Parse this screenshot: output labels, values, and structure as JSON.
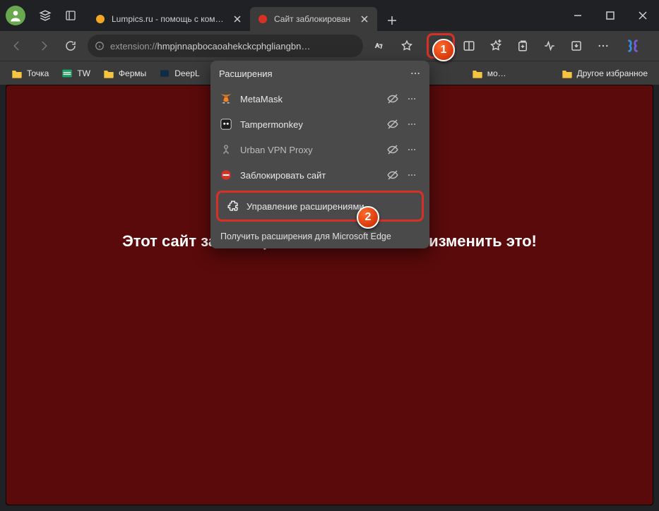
{
  "tabs": [
    {
      "label": "Lumpics.ru - помощь с компьюте",
      "favicon_color": "#f5a623"
    },
    {
      "label": "Сайт заблокирован",
      "favicon_color": "#d93025"
    }
  ],
  "address": {
    "protocol": "extension://",
    "path": "hmpjnnapbocaoahekckcphgliangbn…"
  },
  "bookmarks": {
    "items": [
      {
        "label": "Точка",
        "color": "#f5c542"
      },
      {
        "label": "TW",
        "color": "#1fa463"
      },
      {
        "label": "Фермы",
        "color": "#f5c542"
      },
      {
        "label": "DeepL",
        "color": "#0f2b46"
      },
      {
        "label": "мо…",
        "color": "#f5c542"
      }
    ],
    "other": "Другое избранное"
  },
  "popup": {
    "title": "Расширения",
    "items": [
      {
        "label": "MetaMask",
        "icon": "metamask"
      },
      {
        "label": "Tampermonkey",
        "icon": "tampermonkey"
      },
      {
        "label": "Urban VPN Proxy",
        "icon": "urbanvpn"
      },
      {
        "label": "Заблокировать сайт",
        "icon": "blocksite"
      }
    ],
    "manage": "Управление расширениями",
    "get": "Получить расширения для Microsoft Edge"
  },
  "page": {
    "blocked_message": "Этот сайт заблокирован. Не пытайтесь изменить это!"
  },
  "callouts": {
    "one": "1",
    "two": "2"
  }
}
